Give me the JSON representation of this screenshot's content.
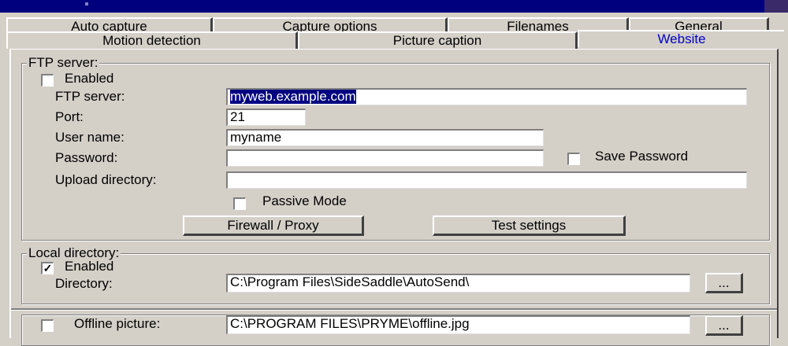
{
  "tabs_row1": [
    "Auto capture",
    "Capture options",
    "Filenames",
    "General"
  ],
  "tabs_row2": [
    "Motion detection",
    "Picture caption",
    "Website"
  ],
  "ftp": {
    "group_title": "FTP server:",
    "enabled_label": "Enabled",
    "enabled_checked": false,
    "server_label": "FTP server:",
    "server_value": "myweb.example.com",
    "port_label": "Port:",
    "port_value": "21",
    "user_label": "User name:",
    "user_value": "myname",
    "password_label": "Password:",
    "password_value": "",
    "save_password_label": "Save Password",
    "upload_label": "Upload directory:",
    "upload_value": "",
    "passive_label": "Passive Mode",
    "firewall_button": "Firewall / Proxy",
    "test_button": "Test settings"
  },
  "local": {
    "group_title": "Local directory:",
    "enabled_label": "Enabled",
    "enabled_checked": true,
    "checkmark": "✓",
    "directory_label": "Directory:",
    "directory_value": "C:\\Program Files\\SideSaddle\\AutoSend\\",
    "browse_button": "..."
  },
  "offline": {
    "label": "Offline picture:",
    "value": "C:\\PROGRAM FILES\\PRYME\\offline.jpg",
    "browse_button": "..."
  }
}
